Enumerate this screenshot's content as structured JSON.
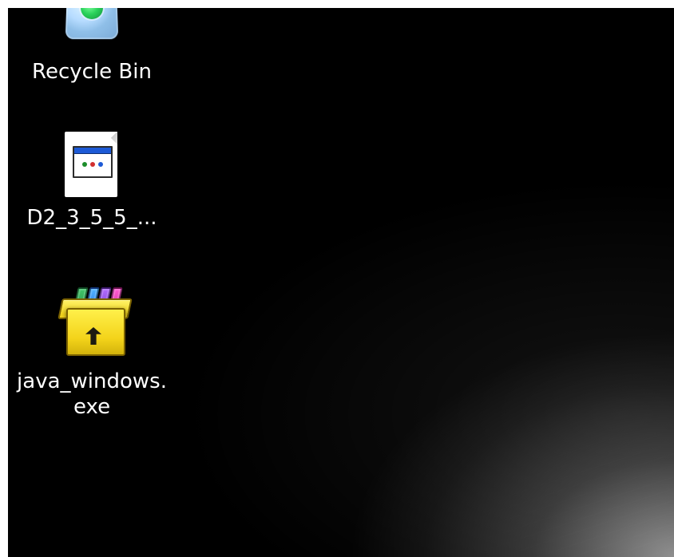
{
  "desktop": {
    "icons": [
      {
        "label": "Recycle Bin",
        "icon": "recycle-bin-icon"
      },
      {
        "label": "D2_3_5_5_...",
        "icon": "web-document-icon"
      },
      {
        "label": "java_windows.\nexe",
        "icon": "installer-box-icon"
      }
    ],
    "colors": {
      "background": "#000000",
      "label_text": "#ffffff"
    }
  }
}
